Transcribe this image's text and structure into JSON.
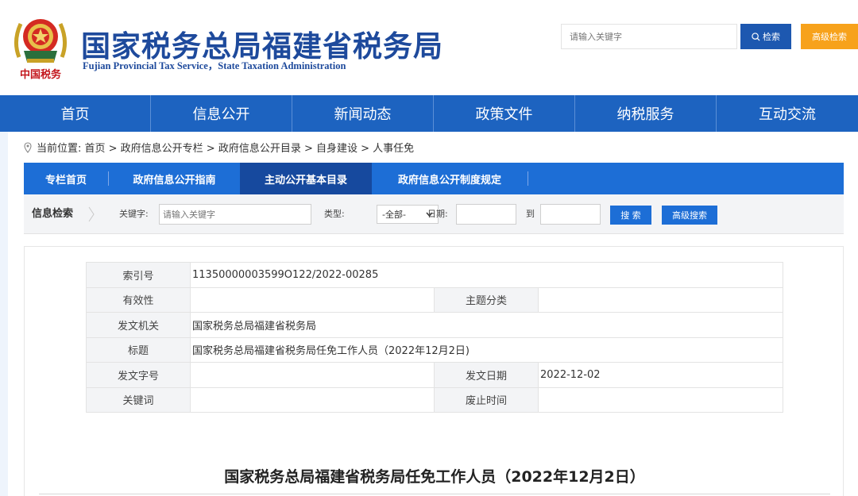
{
  "header": {
    "title": "国家税务总局福建省税务局",
    "subtitle": "Fujian Provincial Tax Service，State Taxation Administration",
    "emblem_icon": "tax-emblem-icon",
    "emblem_caption": "中国税务",
    "search_placeholder": "请输入关键字",
    "search_label": "检索",
    "advanced_label": "高级检索"
  },
  "nav": {
    "items": [
      {
        "label": "首页"
      },
      {
        "label": "信息公开"
      },
      {
        "label": "新闻动态"
      },
      {
        "label": "政策文件"
      },
      {
        "label": "纳税服务"
      },
      {
        "label": "互动交流"
      }
    ]
  },
  "breadcrumb": {
    "text": "当前位置:  首页 > 政府信息公开专栏 > 政府信息公开目录 > 自身建设 > 人事任免"
  },
  "subnav": {
    "items": [
      {
        "label": "专栏首页"
      },
      {
        "label": "政府信息公开指南"
      },
      {
        "label": "主动公开基本目录"
      },
      {
        "label": "政府信息公开制度规定"
      }
    ]
  },
  "info_search": {
    "title": "信息检索",
    "keyword_label": "关键字:",
    "keyword_placeholder": "请输入关键字",
    "type_label": "类型:",
    "type_value": "-全部-",
    "date_label": "日期:",
    "to_label": "到",
    "search_label": "搜 索",
    "advanced_label": "高级搜索"
  },
  "meta": {
    "index_no_label": "索引号",
    "index_no": "11350000003599O122/2022-00285",
    "validity_label": "有效性",
    "validity": "",
    "topic_label": "主题分类",
    "topic": "",
    "issuer_label": "发文机关",
    "issuer": "国家税务总局福建省税务局",
    "title_label": "标题",
    "title": "国家税务总局福建省税务局任免工作人员（2022年12月2日)",
    "doc_no_label": "发文字号",
    "doc_no": "",
    "date_label": "发文日期",
    "date": "2022-12-02",
    "keywords_label": "关键词",
    "keywords": "",
    "expiry_label": "废止时间",
    "expiry": ""
  },
  "article": {
    "title": "国家税务总局福建省税务局任免工作人员（2022年12月2日）"
  },
  "colors": {
    "brand_blue": "#1e4a9c",
    "nav_blue": "#1d63c0",
    "subnav_blue": "#1d6ed6",
    "subnav_active": "#16499e",
    "accent_orange": "#f7a21b"
  }
}
